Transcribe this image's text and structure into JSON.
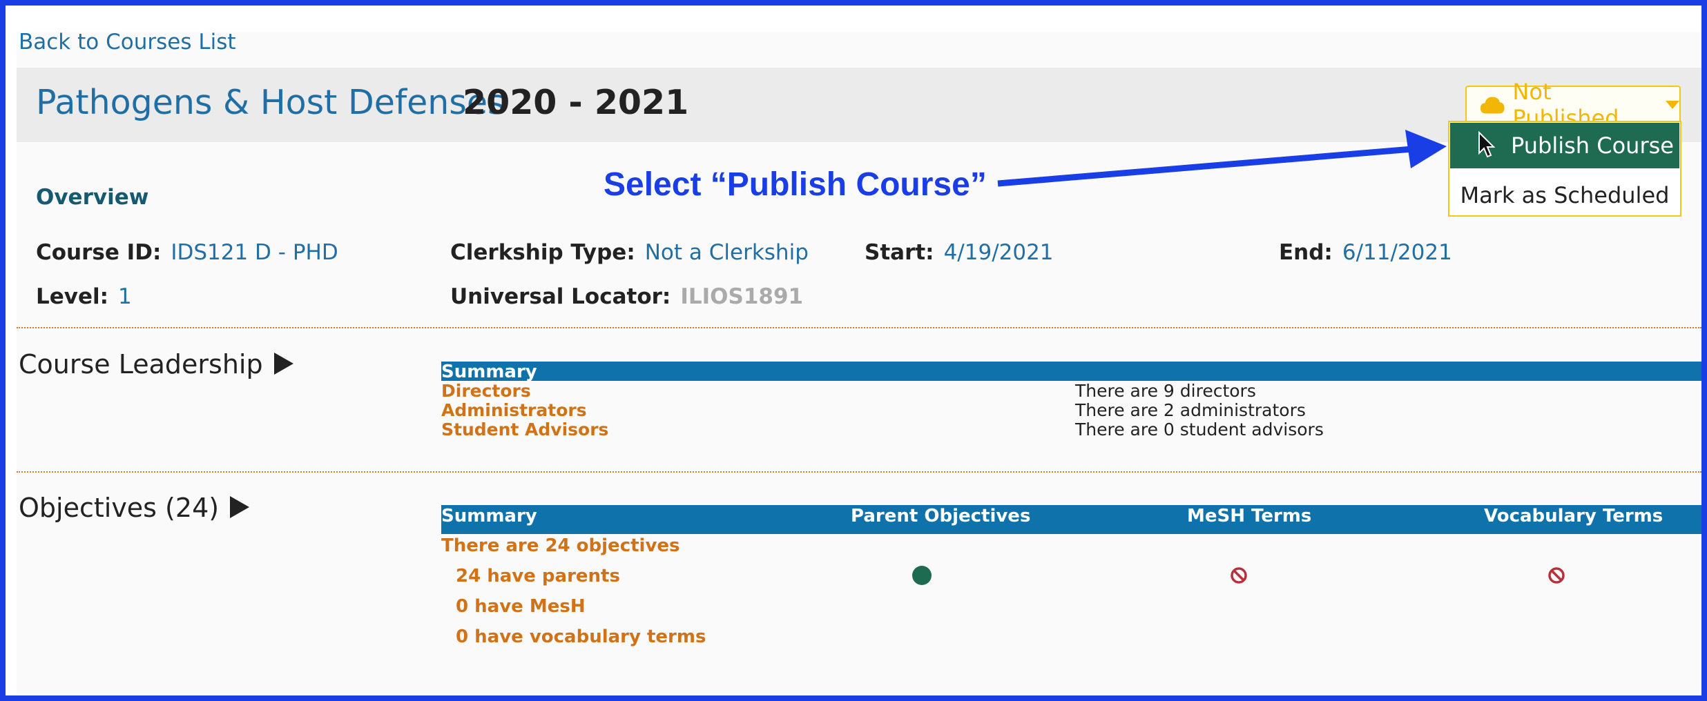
{
  "nav": {
    "back_label": "Back to Courses List"
  },
  "course": {
    "title": "Pathogens & Host Defenses",
    "year": "2020 - 2021"
  },
  "publish": {
    "status_label": "Not Published",
    "menu": {
      "publish_label": "Publish Course",
      "schedule_label": "Mark as Scheduled"
    }
  },
  "annotation": {
    "text": "Select “Publish Course”"
  },
  "overview": {
    "heading": "Overview",
    "course_id": {
      "label": "Course ID:",
      "value": "IDS121 D - PHD"
    },
    "clerkship": {
      "label": "Clerkship Type:",
      "value": "Not a Clerkship"
    },
    "start": {
      "label": "Start:",
      "value": "4/19/2021"
    },
    "end": {
      "label": "End:",
      "value": "6/11/2021"
    },
    "level": {
      "label": "Level:",
      "value": "1"
    },
    "locator": {
      "label": "Universal Locator:",
      "value": "ILIOS1891"
    }
  },
  "leadership": {
    "heading": "Course Leadership",
    "summary_header": "Summary",
    "rows": [
      {
        "label": "Directors",
        "value": "There are 9 directors"
      },
      {
        "label": "Administrators",
        "value": "There are 2 administrators"
      },
      {
        "label": "Student Advisors",
        "value": "There are 0 student advisors"
      }
    ]
  },
  "objectives": {
    "heading": "Objectives (24)",
    "columns": [
      "Summary",
      "Parent Objectives",
      "MeSH Terms",
      "Vocabulary Terms"
    ],
    "summary_line": "There are 24 objectives",
    "details": [
      "24 have parents",
      "0 have MesH",
      "0 have vocabulary terms"
    ],
    "status": {
      "parents": "complete",
      "mesh": "none",
      "vocabulary": "none"
    }
  },
  "colors": {
    "frame": "#1a3ee6",
    "link": "#1f6fa6",
    "header_bar": "#0f72ab",
    "orange_text": "#d27216",
    "publish_green": "#1f6b52",
    "warning_yellow": "#f2b705"
  }
}
